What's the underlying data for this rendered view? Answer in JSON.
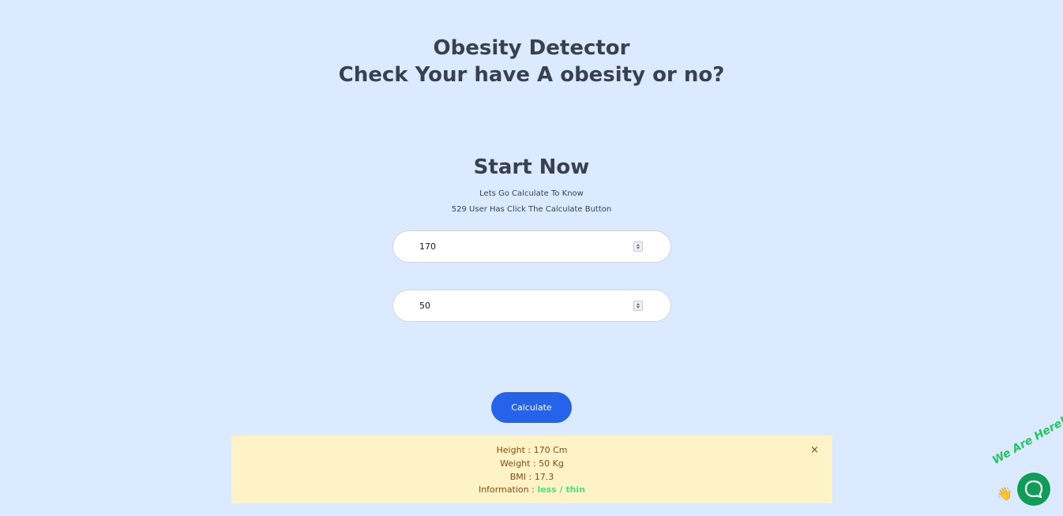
{
  "header": {
    "title_line1": "Obesity Detector",
    "title_line2": "Check Your have A obesity or no?"
  },
  "section": {
    "title": "Start Now",
    "subtitle": "Lets Go Calculate To Know",
    "counter_text": "529 User Has Click The Calculate Button"
  },
  "form": {
    "height_value": "170",
    "weight_value": "50",
    "calculate_label": "Calculate"
  },
  "result": {
    "height_text": "Height : 170 Cm",
    "weight_text": "Weight : 50 Kg",
    "bmi_text": "BMI : 17.3",
    "info_label": "Information :",
    "info_value": "less / thin",
    "close_symbol": "×"
  },
  "chat": {
    "badge_text": "We Are Here!",
    "hand_icon": "waving-hand-icon",
    "bubble_icon": "chat-bubble-icon"
  },
  "colors": {
    "background": "#dbeafe",
    "primary_button": "#2563eb",
    "result_bg": "#fef3c7",
    "result_text": "#854d0e",
    "info_value": "#4ade80",
    "chat_button": "#0f9d58"
  }
}
